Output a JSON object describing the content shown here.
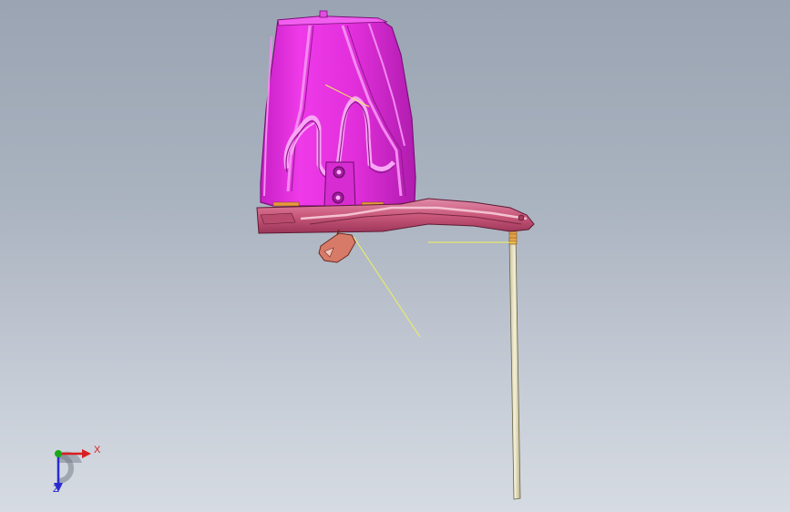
{
  "viewport": {
    "background_top": "#9aa4b2",
    "background_bottom": "#d6dbe3",
    "part_color": "#e22fdc",
    "part_shadow_color": "#b51fb2",
    "flange_color": "#c9587a",
    "bracket_color": "#d77a68",
    "rod_color": "#ece6c4",
    "annotation_line_color": "#f2f25a"
  },
  "triad": {
    "x_label": "X",
    "y_label": "Y",
    "z_label": "Z",
    "x_color": "#d81f1f",
    "y_color": "#1aa81a",
    "z_color": "#2a2ad0"
  }
}
